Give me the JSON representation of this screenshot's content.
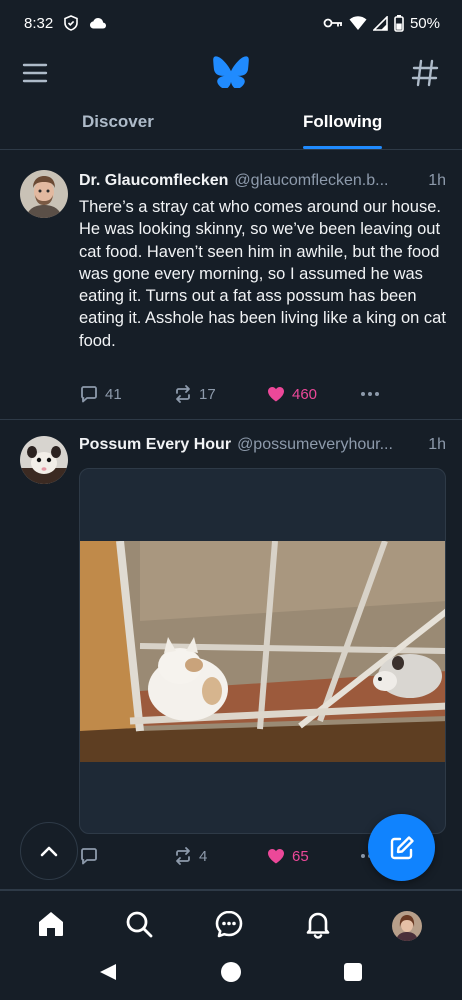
{
  "status_bar": {
    "time": "8:32",
    "battery": "50%",
    "icons": [
      "shield-icon",
      "cloud-icon",
      "vpn-key-icon",
      "wifi-icon",
      "signal-icon",
      "battery-icon"
    ]
  },
  "top_bar": {
    "icons": [
      "menu-icon",
      "bluesky-butterfly-logo",
      "hashtag-feeds-icon"
    ],
    "accent_color": "#208bfe"
  },
  "tabs": [
    {
      "label": "Discover",
      "active": false
    },
    {
      "label": "Following",
      "active": true
    }
  ],
  "posts": [
    {
      "display_name": "Dr. Glaucomflecken",
      "handle": "@glaucomflecken.b...",
      "time": "1h",
      "text": "There’s a stray cat who comes around our house. He was looking skinny, so we’ve been leaving out cat food. Haven’t seen him in awhile, but the food was gone every morning, so I assumed he was eating it. Turns out a fat ass possum has been eating it. Asshole has been living like a king on cat food.",
      "replies": "41",
      "reposts": "17",
      "likes": "460",
      "liked": true
    },
    {
      "display_name": "Possum Every Hour",
      "handle": "@possumeveryhour...",
      "time": "1h",
      "text": "",
      "replies": "",
      "reposts": "4",
      "likes": "65",
      "liked": true,
      "media": "Photo through a window: a white-and-tan cat and a possum sitting at the window"
    }
  ],
  "bottom_nav": {
    "items": [
      "home-icon",
      "search-icon",
      "chat-icon",
      "notifications-icon",
      "profile-avatar"
    ]
  },
  "colors": {
    "background": "#161e27",
    "like": "#ec4899",
    "muted": "#8d9aab",
    "fab": "#1083fe"
  }
}
